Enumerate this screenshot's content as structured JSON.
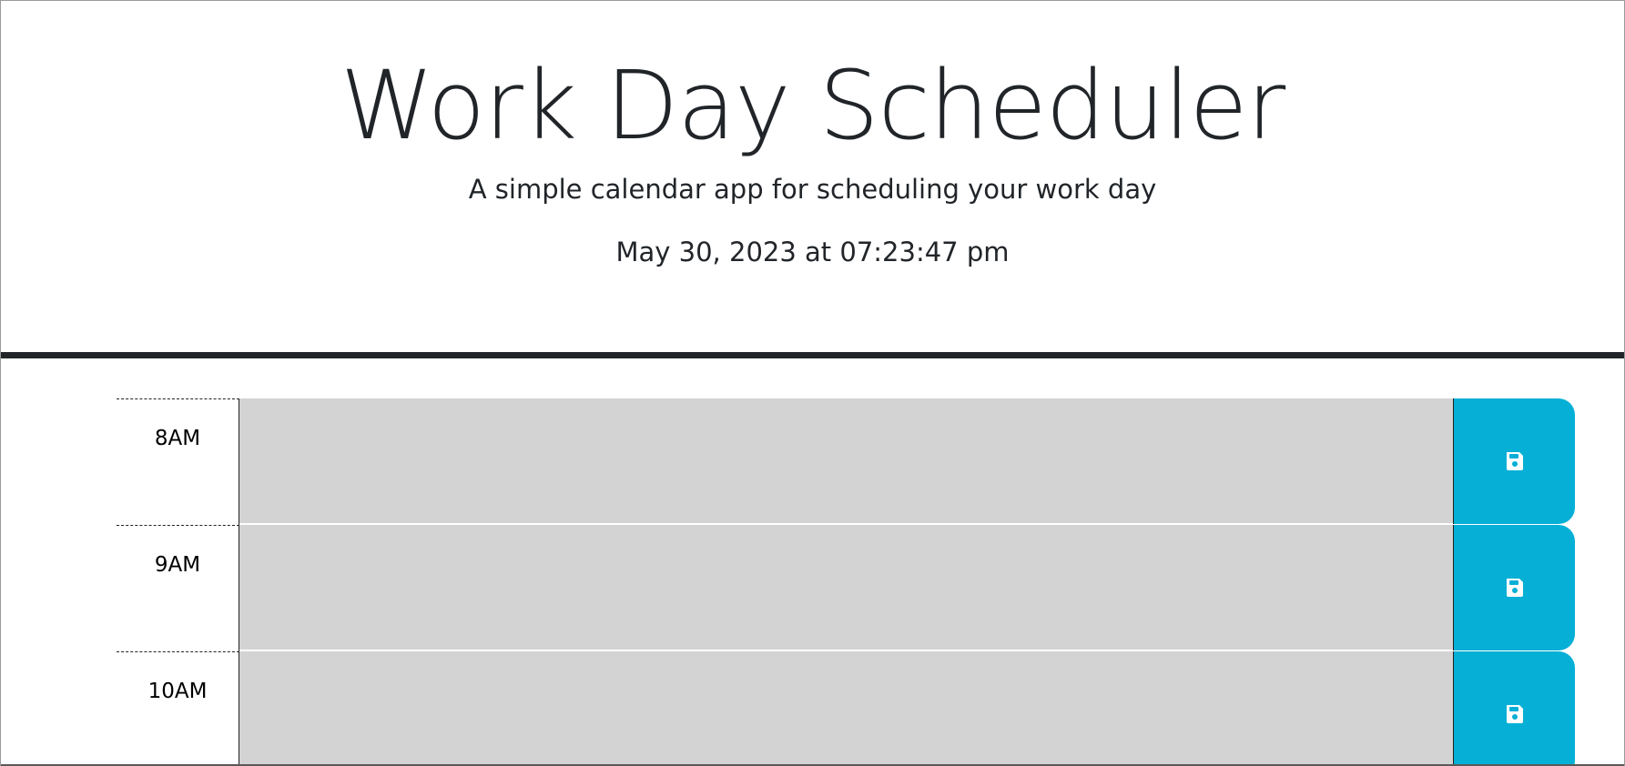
{
  "header": {
    "title": "Work Day Scheduler",
    "subtitle": "A simple calendar app for scheduling your work day",
    "current_day": "May 30, 2023 at 07:23:47 pm"
  },
  "time_blocks": [
    {
      "hour": "8AM",
      "description": "",
      "save_icon": "save-icon"
    },
    {
      "hour": "9AM",
      "description": "",
      "save_icon": "save-icon"
    },
    {
      "hour": "10AM",
      "description": "",
      "save_icon": "save-icon"
    }
  ],
  "colors": {
    "past_block": "#d3d3d3",
    "save_button": "#06afd6",
    "header_rule": "#212529",
    "text": "#212529"
  }
}
